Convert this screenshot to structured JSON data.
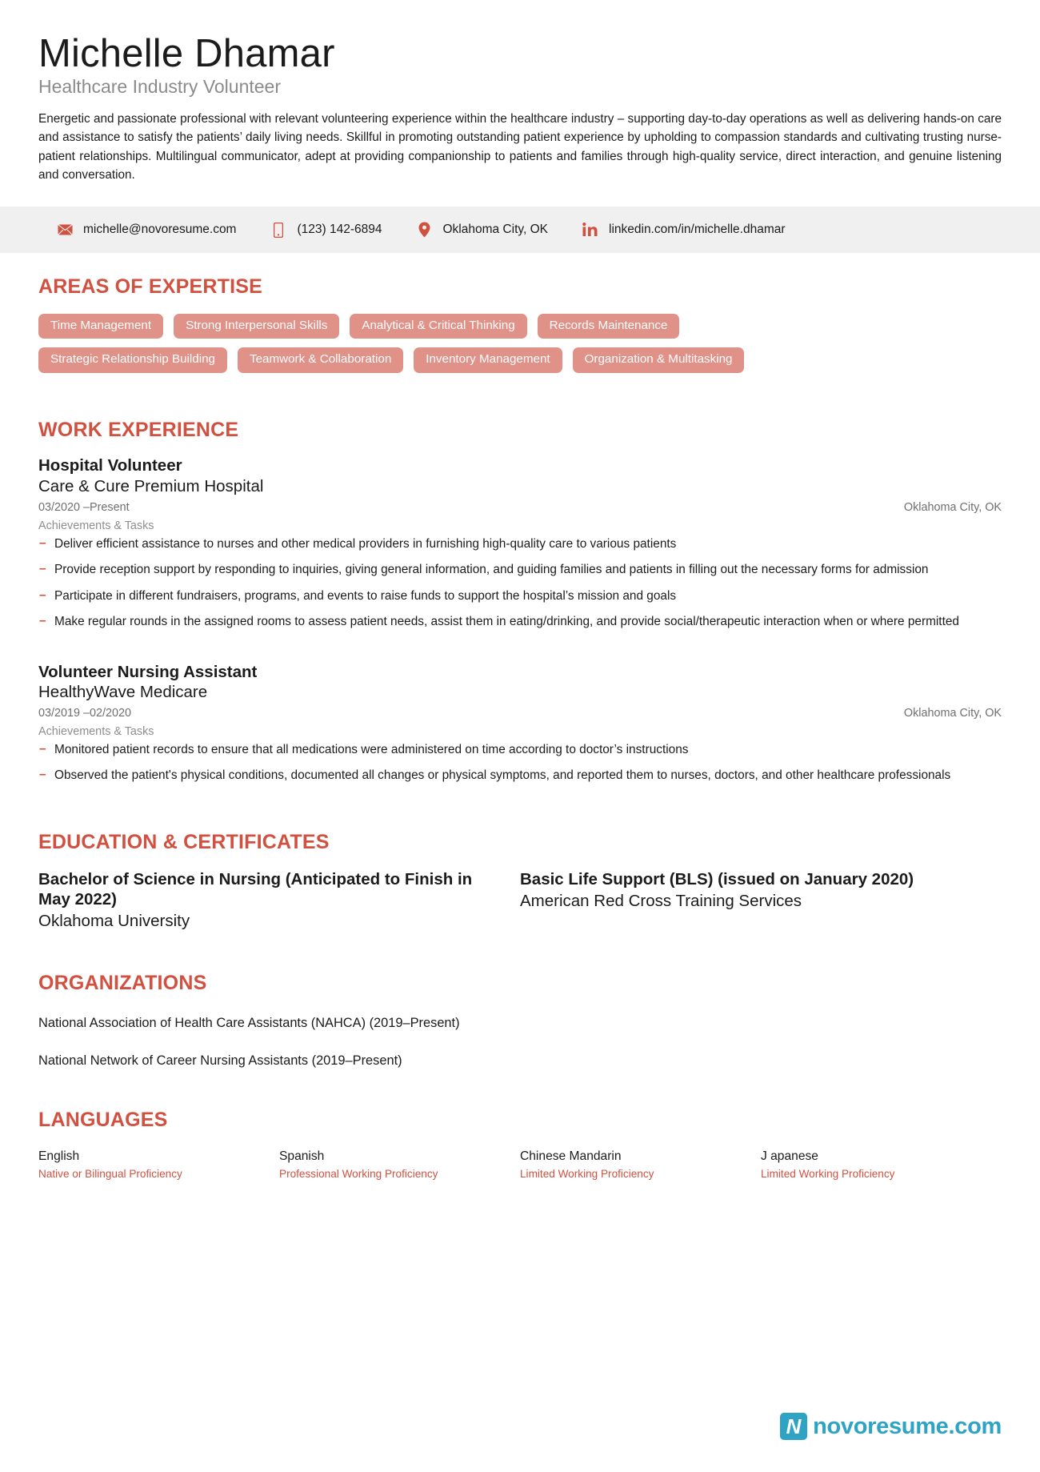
{
  "header": {
    "name": "Michelle Dhamar",
    "job_title": "Healthcare Industry Volunteer",
    "summary": "Energetic and passionate professional with relevant volunteering experience within the healthcare industry – supporting day-to-day operations as well as delivering hands-on care and assistance to satisfy the patients’ daily living needs. Skillful in promoting outstanding patient experience by upholding to compassion standards and cultivating trusting nurse-patient relationships. Multilingual communicator, adept at providing companionship to patients and families through high-quality service, direct interaction, and genuine listening and conversation."
  },
  "contact": [
    {
      "icon": "envelope-icon",
      "value": "michelle@novoresume.com"
    },
    {
      "icon": "phone-icon",
      "value": "(123) 142-6894"
    },
    {
      "icon": "location-pin-icon",
      "value": "Oklahoma City, OK"
    },
    {
      "icon": "linkedin-icon",
      "value": "linkedin.com/in/michelle.dhamar"
    }
  ],
  "expertise": {
    "title": "AREAS OF EXPERTISE",
    "rows": [
      [
        "Time Management",
        "Strong Interpersonal Skills",
        "Analytical & Critical Thinking",
        "Records Maintenance"
      ],
      [
        "Strategic Relationship Building",
        "Teamwork & Collaboration",
        "Inventory Management",
        "Organization & Multitasking"
      ]
    ]
  },
  "work": {
    "title": "WORK EXPERIENCE",
    "jobs": [
      {
        "role": "Hospital Volunteer",
        "company": "Care & Cure Premium Hospital",
        "dates": "03/2020 –Present",
        "location": "Oklahoma City, OK",
        "sub_label": "Achievements & Tasks",
        "bullets": [
          "Deliver efficient assistance to nurses and other medical providers in furnishing high-quality care to various patients",
          "Provide reception support by responding to inquiries, giving general information, and guiding families and patients in filling out the necessary forms for admission",
          "Participate in different fundraisers, programs, and events to raise funds to support the hospital’s mission and goals",
          "Make regular rounds in the assigned rooms to assess patient needs, assist them in eating/drinking, and provide social/therapeutic interaction when or where permitted"
        ]
      },
      {
        "role": "Volunteer Nursing Assistant",
        "company": "HealthyWave Medicare",
        "dates": "03/2019 –02/2020",
        "location": "Oklahoma City, OK",
        "sub_label": "Achievements & Tasks",
        "bullets": [
          "Monitored patient records to ensure that all medications were administered on time according to doctor’s instructions",
          "Observed the patient's physical conditions, documented all changes or physical symptoms, and reported them to nurses, doctors, and other healthcare professionals"
        ]
      }
    ]
  },
  "education": {
    "title": "EDUCATION & CERTIFICATES",
    "items": [
      {
        "degree": "Bachelor of Science in Nursing (Anticipated to Finish in May 2022)",
        "school": "Oklahoma University"
      },
      {
        "degree": "Basic Life Support (BLS) (issued on January 2020)",
        "school": "American Red Cross Training Services"
      }
    ]
  },
  "organizations": {
    "title": "ORGANIZATIONS",
    "items": [
      "National Association of Health Care Assistants (NAHCA) (2019–Present)",
      "National Network of Career Nursing Assistants (2019–Present)"
    ]
  },
  "languages": {
    "title": "LANGUAGES",
    "items": [
      {
        "name": "English",
        "level": "Native or Bilingual Proficiency"
      },
      {
        "name": "Spanish",
        "level": "Professional Working Proficiency"
      },
      {
        "name": "Chinese Mandarin",
        "level": "Limited Working Proficiency"
      },
      {
        "name": "J apanese",
        "level": "Limited Working Proficiency"
      }
    ]
  },
  "footer": {
    "logo_mark": "N",
    "logo_text": "novoresume.com"
  },
  "colors": {
    "accent": "#d1503f",
    "tag_bg": "#e09288",
    "contact_bar_bg": "#f0f0f0",
    "logo": "#2ea3c4"
  }
}
